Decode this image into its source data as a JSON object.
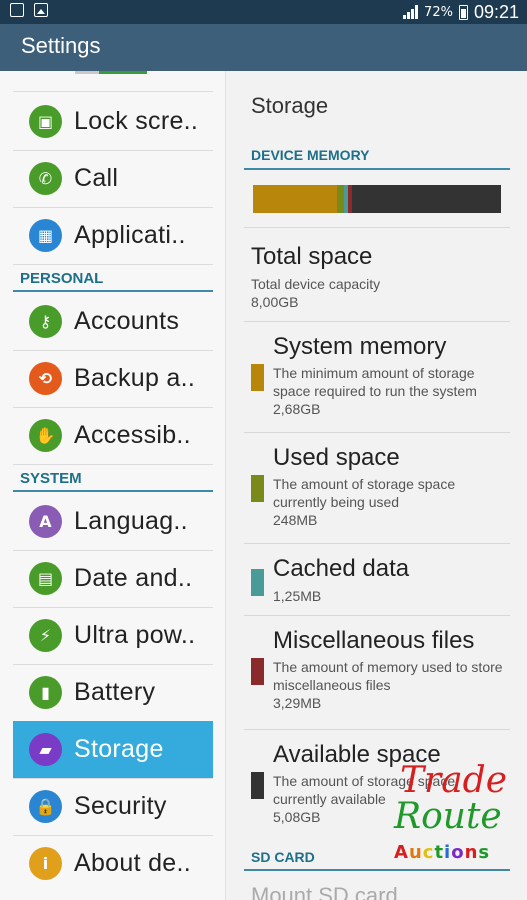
{
  "status_bar": {
    "battery_percent": "72%",
    "time": "09:21",
    "icons": [
      "screenshot-icon",
      "gallery-icon",
      "signal-icon",
      "battery-icon"
    ]
  },
  "action_bar": {
    "title": "Settings"
  },
  "left_pane": {
    "groups": [
      {
        "heading": "",
        "items": [
          {
            "label": "Lock scre..",
            "icon": "lock-screen-icon",
            "color": "#4a9c2a"
          },
          {
            "label": "Call",
            "icon": "phone-icon",
            "color": "#4a9c2a"
          },
          {
            "label": "Applicati..",
            "icon": "apps-grid-icon",
            "color": "#2a86d2"
          }
        ]
      },
      {
        "heading": "PERSONAL",
        "items": [
          {
            "label": "Accounts",
            "icon": "key-icon",
            "color": "#4a9c2a"
          },
          {
            "label": "Backup a..",
            "icon": "backup-icon",
            "color": "#e45a1c"
          },
          {
            "label": "Accessib..",
            "icon": "hand-icon",
            "color": "#4a9c2a"
          }
        ]
      },
      {
        "heading": "SYSTEM",
        "items": [
          {
            "label": "Languag..",
            "icon": "language-icon",
            "color": "#8a5cb3"
          },
          {
            "label": "Date and..",
            "icon": "calendar-icon",
            "color": "#4a9c2a"
          },
          {
            "label": "Ultra pow..",
            "icon": "ultra-power-icon",
            "color": "#4a9c2a"
          },
          {
            "label": "Battery",
            "icon": "battery-icon",
            "color": "#4a9c2a"
          },
          {
            "label": "Storage",
            "icon": "sd-card-icon",
            "color": "#7a3cc6",
            "selected": true
          },
          {
            "label": "Security",
            "icon": "lock-icon",
            "color": "#2a86d2"
          },
          {
            "label": "About de..",
            "icon": "info-icon",
            "color": "#e0a01c"
          }
        ]
      }
    ]
  },
  "storage": {
    "title": "Storage",
    "device_memory_heading": "DEVICE MEMORY",
    "usage_bar_fractions": [
      {
        "name": "System memory",
        "fraction": 0.34,
        "color": "#b8860b"
      },
      {
        "name": "Used space",
        "fraction": 0.03,
        "color": "#7a8a1a"
      },
      {
        "name": "Cached data",
        "fraction": 0.015,
        "color": "#4a9a9a"
      },
      {
        "name": "Miscellaneous files",
        "fraction": 0.015,
        "color": "#8a2a2a"
      },
      {
        "name": "Available space",
        "fraction": 0.6,
        "color": "#333333"
      }
    ],
    "total": {
      "title": "Total space",
      "desc": "Total device capacity",
      "value": "8,00GB"
    },
    "entries": [
      {
        "title": "System memory",
        "desc": "The minimum amount of storage space required to run the system",
        "value": "2,68GB",
        "color": "#b8860b"
      },
      {
        "title": "Used space",
        "desc": "The amount of storage space currently being used",
        "value": "248MB",
        "color": "#7a8a1a"
      },
      {
        "title": "Cached data",
        "desc": "",
        "value": "1,25MB",
        "color": "#4a9a9a"
      },
      {
        "title": "Miscellaneous files",
        "desc": "The amount of memory used to store miscellaneous files",
        "value": "3,29MB",
        "color": "#8a2a2a"
      },
      {
        "title": "Available space",
        "desc": "The amount of storage space currently available",
        "value": "5,08GB",
        "color": "#333333"
      }
    ],
    "sd_card_heading": "SD CARD",
    "mount_label": "Mount SD card"
  },
  "watermark": {
    "line1": "Trade",
    "line2": "Route",
    "line3": "Auctions"
  }
}
